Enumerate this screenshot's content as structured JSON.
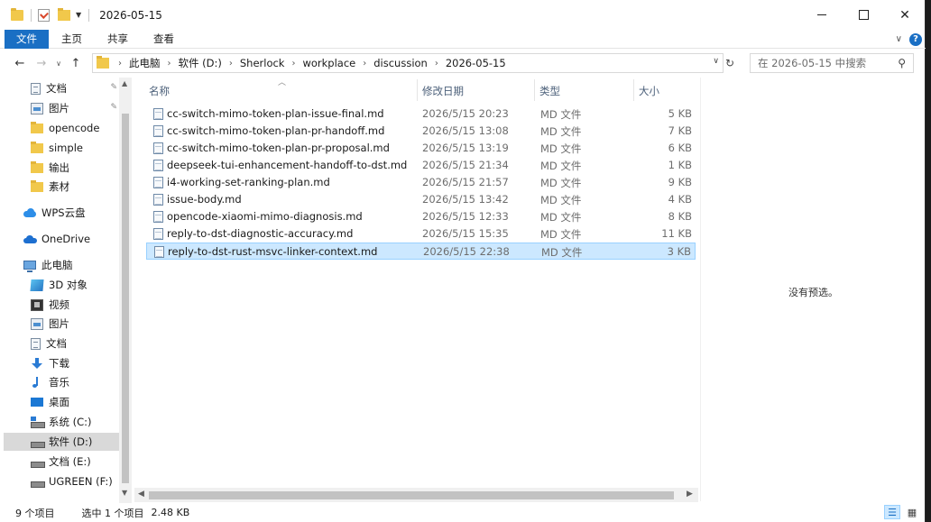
{
  "window": {
    "title": "2026-05-15",
    "controls": {
      "minimize": "",
      "maximize": "",
      "close": "✕"
    }
  },
  "ribbon": {
    "tabs": [
      {
        "label": "文件"
      },
      {
        "label": "主页"
      },
      {
        "label": "共享"
      },
      {
        "label": "查看"
      }
    ]
  },
  "address": {
    "breadcrumbs": [
      "此电脑",
      "软件 (D:)",
      "Sherlock",
      "workplace",
      "discussion",
      "2026-05-15"
    ],
    "search_placeholder": "在 2026-05-15 中搜索"
  },
  "nav": {
    "items": [
      {
        "label": "文档",
        "icon": "document-icon",
        "pinned": true
      },
      {
        "label": "图片",
        "icon": "picture-icon",
        "pinned": true
      },
      {
        "label": "opencode",
        "icon": "folder-icon"
      },
      {
        "label": "simple",
        "icon": "folder-icon"
      },
      {
        "label": "输出",
        "icon": "folder-icon"
      },
      {
        "label": "素材",
        "icon": "folder-icon"
      },
      {
        "label": "WPS云盘",
        "icon": "wps-cloud-icon"
      },
      {
        "label": "OneDrive",
        "icon": "onedrive-icon"
      },
      {
        "label": "此电脑",
        "icon": "this-pc-icon"
      },
      {
        "label": "3D 对象",
        "icon": "3d-objects-icon"
      },
      {
        "label": "视频",
        "icon": "video-icon"
      },
      {
        "label": "图片",
        "icon": "picture-icon"
      },
      {
        "label": "文档",
        "icon": "document-icon"
      },
      {
        "label": "下载",
        "icon": "download-icon"
      },
      {
        "label": "音乐",
        "icon": "music-icon"
      },
      {
        "label": "桌面",
        "icon": "desktop-icon"
      },
      {
        "label": "系统 (C:)",
        "icon": "system-drive-icon"
      },
      {
        "label": "软件 (D:)",
        "icon": "drive-icon"
      },
      {
        "label": "文档 (E:)",
        "icon": "drive-icon"
      },
      {
        "label": "UGREEN (F:)",
        "icon": "drive-icon"
      }
    ]
  },
  "list": {
    "columns": {
      "name": "名称",
      "date": "修改日期",
      "type": "类型",
      "size": "大小"
    },
    "files": [
      {
        "name": "cc-switch-mimo-token-plan-issue-final.md",
        "date": "2026/5/15 20:23",
        "type": "MD 文件",
        "size": "5 KB"
      },
      {
        "name": "cc-switch-mimo-token-plan-pr-handoff.md",
        "date": "2026/5/15 13:08",
        "type": "MD 文件",
        "size": "7 KB"
      },
      {
        "name": "cc-switch-mimo-token-plan-pr-proposal.md",
        "date": "2026/5/15 13:19",
        "type": "MD 文件",
        "size": "6 KB"
      },
      {
        "name": "deepseek-tui-enhancement-handoff-to-dst.md",
        "date": "2026/5/15 21:34",
        "type": "MD 文件",
        "size": "1 KB"
      },
      {
        "name": "i4-working-set-ranking-plan.md",
        "date": "2026/5/15 21:57",
        "type": "MD 文件",
        "size": "9 KB"
      },
      {
        "name": "issue-body.md",
        "date": "2026/5/15 13:42",
        "type": "MD 文件",
        "size": "4 KB"
      },
      {
        "name": "opencode-xiaomi-mimo-diagnosis.md",
        "date": "2026/5/15 12:33",
        "type": "MD 文件",
        "size": "8 KB"
      },
      {
        "name": "reply-to-dst-diagnostic-accuracy.md",
        "date": "2026/5/15 15:35",
        "type": "MD 文件",
        "size": "11 KB"
      },
      {
        "name": "reply-to-dst-rust-msvc-linker-context.md",
        "date": "2026/5/15 22:38",
        "type": "MD 文件",
        "size": "3 KB"
      }
    ]
  },
  "preview": {
    "message": "没有预选。"
  },
  "status": {
    "count": "9 个项目",
    "selection": "选中 1 个项目",
    "selection_size": "2.48 KB"
  },
  "colors": {
    "accent": "#1a6fc4",
    "selection": "#cce8ff"
  }
}
